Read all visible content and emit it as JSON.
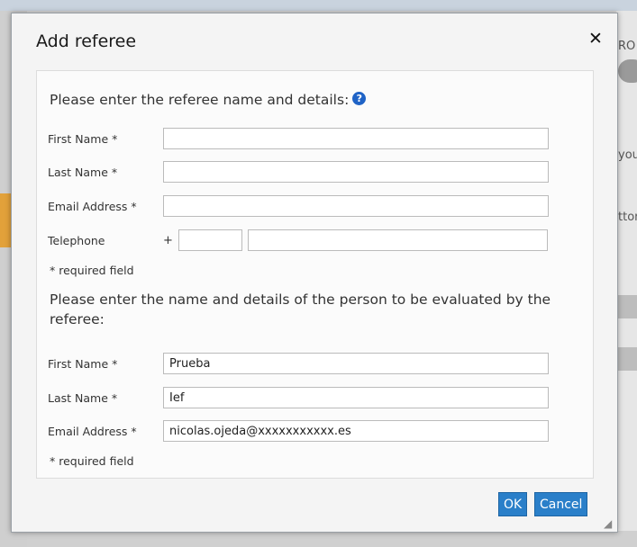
{
  "background": {
    "fragments": [
      "RO",
      "you",
      "ttor"
    ]
  },
  "dialog": {
    "title": "Add referee",
    "close_icon": "close-icon",
    "referee_section": {
      "heading": "Please enter the referee name and details:",
      "help_icon": "?",
      "first_name_label": "First Name *",
      "last_name_label": "Last Name *",
      "email_label": "Email Address *",
      "telephone_label": "Telephone",
      "telephone_prefix": "+",
      "first_name_value": "",
      "last_name_value": "",
      "email_value": "",
      "phone_code_value": "",
      "phone_number_value": "",
      "required_note": "* required field"
    },
    "evaluated_section": {
      "heading": "Please enter the name and details of the person to be evaluated by the referee:",
      "first_name_label": "First Name *",
      "last_name_label": "Last Name *",
      "email_label": "Email Address *",
      "first_name_value": "Prueba",
      "last_name_value": "Ief",
      "email_value": "nicolas.ojeda@xxxxxxxxxxx.es",
      "required_note": "* required field"
    },
    "buttons": {
      "ok": "OK",
      "cancel": "Cancel"
    },
    "colors": {
      "button_blue": "#2a7fc9",
      "help_blue": "#1f63c6"
    }
  }
}
